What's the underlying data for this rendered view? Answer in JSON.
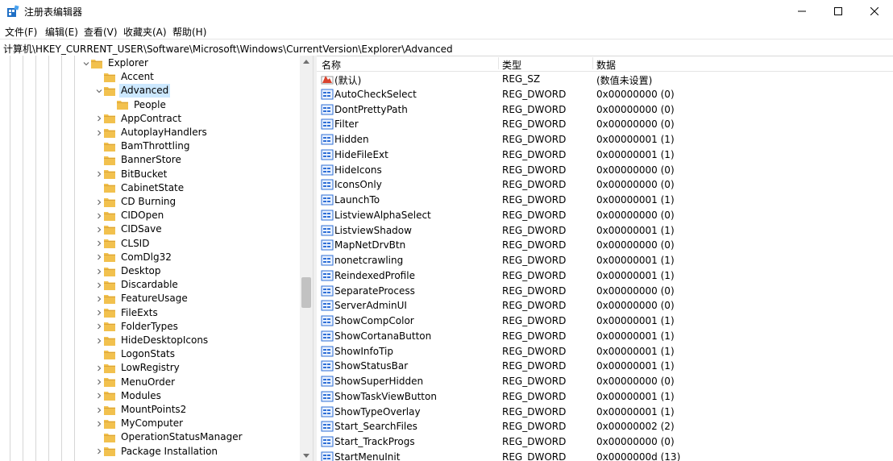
{
  "window": {
    "title": "注册表编辑器",
    "minimize_glyph": "—",
    "maximize_glyph": "☐",
    "close_glyph": "✕"
  },
  "menu": [
    "文件(F)",
    "编辑(E)",
    "查看(V)",
    "收藏夹(A)",
    "帮助(H)"
  ],
  "address": "计算机\\HKEY_CURRENT_USER\\Software\\Microsoft\\Windows\\CurrentVersion\\Explorer\\Advanced",
  "tree": {
    "items": [
      {
        "label": "Explorer",
        "expander": "expanded"
      },
      {
        "label": "Accent",
        "expander": "none"
      },
      {
        "label": "Advanced",
        "expander": "expanded",
        "selected": true
      },
      {
        "label": "People",
        "expander": "none"
      },
      {
        "label": "AppContract",
        "expander": "collapsed"
      },
      {
        "label": "AutoplayHandlers",
        "expander": "collapsed"
      },
      {
        "label": "BamThrottling",
        "expander": "none"
      },
      {
        "label": "BannerStore",
        "expander": "none"
      },
      {
        "label": "BitBucket",
        "expander": "collapsed"
      },
      {
        "label": "CabinetState",
        "expander": "none"
      },
      {
        "label": "CD Burning",
        "expander": "collapsed"
      },
      {
        "label": "CIDOpen",
        "expander": "collapsed"
      },
      {
        "label": "CIDSave",
        "expander": "collapsed"
      },
      {
        "label": "CLSID",
        "expander": "collapsed"
      },
      {
        "label": "ComDlg32",
        "expander": "collapsed"
      },
      {
        "label": "Desktop",
        "expander": "collapsed"
      },
      {
        "label": "Discardable",
        "expander": "collapsed"
      },
      {
        "label": "FeatureUsage",
        "expander": "collapsed"
      },
      {
        "label": "FileExts",
        "expander": "collapsed"
      },
      {
        "label": "FolderTypes",
        "expander": "collapsed"
      },
      {
        "label": "HideDesktopIcons",
        "expander": "collapsed"
      },
      {
        "label": "LogonStats",
        "expander": "none"
      },
      {
        "label": "LowRegistry",
        "expander": "collapsed"
      },
      {
        "label": "MenuOrder",
        "expander": "collapsed"
      },
      {
        "label": "Modules",
        "expander": "collapsed"
      },
      {
        "label": "MountPoints2",
        "expander": "collapsed"
      },
      {
        "label": "MyComputer",
        "expander": "collapsed"
      },
      {
        "label": "OperationStatusManager",
        "expander": "none"
      },
      {
        "label": "Package Installation",
        "expander": "collapsed"
      }
    ]
  },
  "list": {
    "columns": [
      "名称",
      "类型",
      "数据"
    ],
    "rows": [
      {
        "name": "(默认)",
        "type": "REG_SZ",
        "data": "(数值未设置)",
        "icon": "string-value-icon"
      },
      {
        "name": "AutoCheckSelect",
        "type": "REG_DWORD",
        "data": "0x00000000 (0)",
        "icon": "binary-value-icon"
      },
      {
        "name": "DontPrettyPath",
        "type": "REG_DWORD",
        "data": "0x00000000 (0)",
        "icon": "binary-value-icon"
      },
      {
        "name": "Filter",
        "type": "REG_DWORD",
        "data": "0x00000000 (0)",
        "icon": "binary-value-icon"
      },
      {
        "name": "Hidden",
        "type": "REG_DWORD",
        "data": "0x00000001 (1)",
        "icon": "binary-value-icon"
      },
      {
        "name": "HideFileExt",
        "type": "REG_DWORD",
        "data": "0x00000001 (1)",
        "icon": "binary-value-icon"
      },
      {
        "name": "HideIcons",
        "type": "REG_DWORD",
        "data": "0x00000000 (0)",
        "icon": "binary-value-icon"
      },
      {
        "name": "IconsOnly",
        "type": "REG_DWORD",
        "data": "0x00000000 (0)",
        "icon": "binary-value-icon"
      },
      {
        "name": "LaunchTo",
        "type": "REG_DWORD",
        "data": "0x00000001 (1)",
        "icon": "binary-value-icon"
      },
      {
        "name": "ListviewAlphaSelect",
        "type": "REG_DWORD",
        "data": "0x00000000 (0)",
        "icon": "binary-value-icon"
      },
      {
        "name": "ListviewShadow",
        "type": "REG_DWORD",
        "data": "0x00000001 (1)",
        "icon": "binary-value-icon"
      },
      {
        "name": "MapNetDrvBtn",
        "type": "REG_DWORD",
        "data": "0x00000000 (0)",
        "icon": "binary-value-icon"
      },
      {
        "name": "nonetcrawling",
        "type": "REG_DWORD",
        "data": "0x00000001 (1)",
        "icon": "binary-value-icon"
      },
      {
        "name": "ReindexedProfile",
        "type": "REG_DWORD",
        "data": "0x00000001 (1)",
        "icon": "binary-value-icon"
      },
      {
        "name": "SeparateProcess",
        "type": "REG_DWORD",
        "data": "0x00000000 (0)",
        "icon": "binary-value-icon"
      },
      {
        "name": "ServerAdminUI",
        "type": "REG_DWORD",
        "data": "0x00000000 (0)",
        "icon": "binary-value-icon"
      },
      {
        "name": "ShowCompColor",
        "type": "REG_DWORD",
        "data": "0x00000001 (1)",
        "icon": "binary-value-icon"
      },
      {
        "name": "ShowCortanaButton",
        "type": "REG_DWORD",
        "data": "0x00000001 (1)",
        "icon": "binary-value-icon"
      },
      {
        "name": "ShowInfoTip",
        "type": "REG_DWORD",
        "data": "0x00000001 (1)",
        "icon": "binary-value-icon"
      },
      {
        "name": "ShowStatusBar",
        "type": "REG_DWORD",
        "data": "0x00000001 (1)",
        "icon": "binary-value-icon"
      },
      {
        "name": "ShowSuperHidden",
        "type": "REG_DWORD",
        "data": "0x00000000 (0)",
        "icon": "binary-value-icon"
      },
      {
        "name": "ShowTaskViewButton",
        "type": "REG_DWORD",
        "data": "0x00000001 (1)",
        "icon": "binary-value-icon"
      },
      {
        "name": "ShowTypeOverlay",
        "type": "REG_DWORD",
        "data": "0x00000001 (1)",
        "icon": "binary-value-icon"
      },
      {
        "name": "Start_SearchFiles",
        "type": "REG_DWORD",
        "data": "0x00000002 (2)",
        "icon": "binary-value-icon"
      },
      {
        "name": "Start_TrackProgs",
        "type": "REG_DWORD",
        "data": "0x00000000 (0)",
        "icon": "binary-value-icon"
      },
      {
        "name": "StartMenuInit",
        "type": "REG_DWORD",
        "data": "0x0000000d (13)",
        "icon": "binary-value-icon"
      }
    ]
  },
  "colors": {
    "folder": "#f2c14e",
    "folder_dark": "#dca437",
    "selection": "#cce8ff",
    "binary_icon": "#2f6fd6",
    "string_icon": "#d9432e"
  },
  "tree_scrollbar": {
    "thumb_start": 0.55,
    "thumb_end": 0.63
  }
}
